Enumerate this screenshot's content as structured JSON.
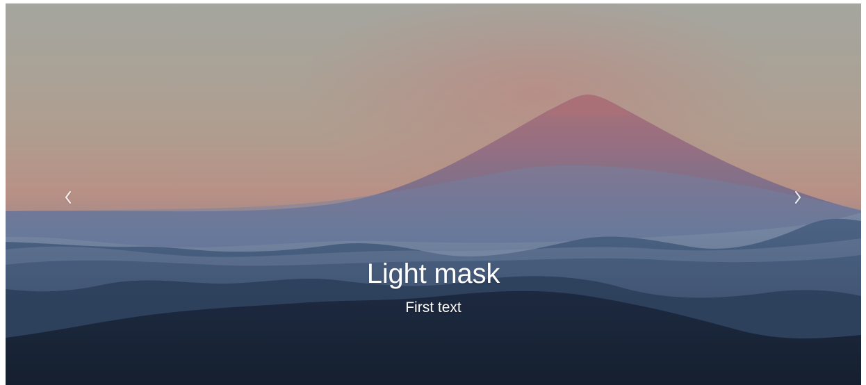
{
  "carousel": {
    "caption": {
      "title": "Light mask",
      "text": "First text"
    },
    "controls": {
      "previous_icon": "chevron-left-icon",
      "next_icon": "chevron-right-icon"
    },
    "colors": {
      "sky_top": "#a2a49c",
      "sky_warm": "#b68d82",
      "mountain_peak": "#a26f78",
      "mountain_blue": "#445a7c",
      "foreground_dark": "#101b2e",
      "text": "#ffffff"
    }
  }
}
